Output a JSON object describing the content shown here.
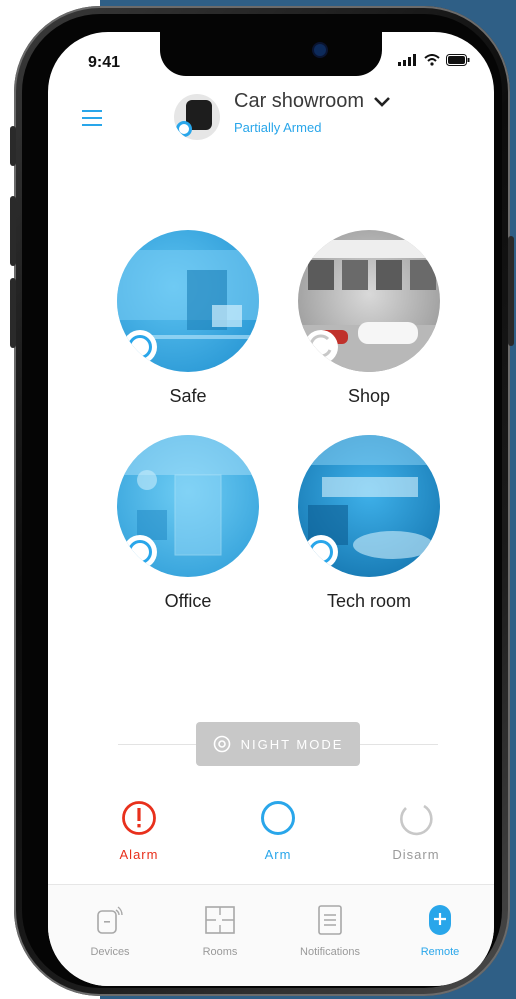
{
  "status_bar": {
    "time": "9:41"
  },
  "header": {
    "title": "Car showroom",
    "subtitle": "Partially Armed"
  },
  "rooms": [
    {
      "name": "Safe",
      "state": "armed"
    },
    {
      "name": "Shop",
      "state": "disarmed"
    },
    {
      "name": "Office",
      "state": "armed"
    },
    {
      "name": "Tech room",
      "state": "armed"
    }
  ],
  "night_mode": {
    "label": "NIGHT MODE"
  },
  "actions": {
    "alarm": "Alarm",
    "arm": "Arm",
    "disarm": "Disarm"
  },
  "tabs": [
    {
      "label": "Devices",
      "icon": "devices-icon"
    },
    {
      "label": "Rooms",
      "icon": "rooms-icon"
    },
    {
      "label": "Notifications",
      "icon": "notifications-icon"
    },
    {
      "label": "Remote",
      "icon": "remote-icon",
      "active": true
    }
  ],
  "colors": {
    "accent": "#29a6ea",
    "alarm": "#e8301c",
    "disabled": "#c8c8c8",
    "background_panel": "#2f5f86"
  }
}
